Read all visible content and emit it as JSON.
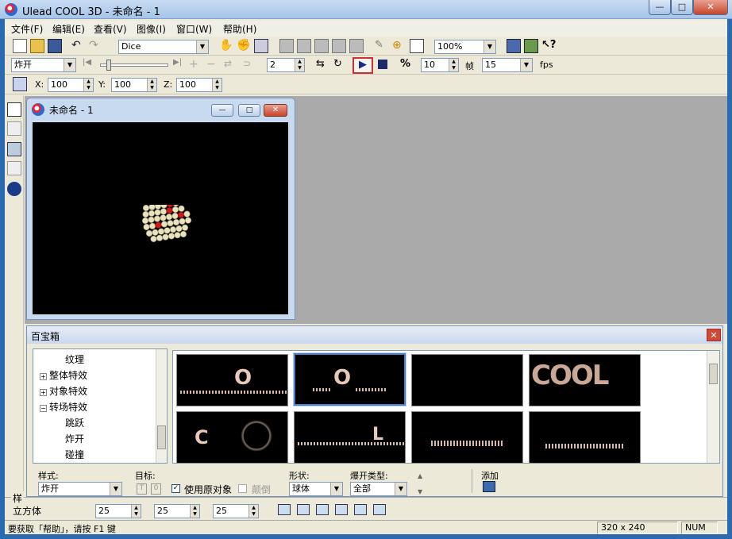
{
  "app": {
    "title": "Ulead COOL 3D - 未命名 - 1"
  },
  "window_buttons": {
    "min": "—",
    "max": "□",
    "close": "✕"
  },
  "menu": [
    "文件(F)",
    "编辑(E)",
    "查看(V)",
    "图像(I)",
    "窗口(W)",
    "帮助(H)"
  ],
  "toolbar1": {
    "font_style": "Dice",
    "zoom": "100%"
  },
  "toolbar2": {
    "effect": "炸开",
    "frame_value": "2",
    "speed": "10",
    "frame_label": "帧",
    "fps_value": "15",
    "fps_label": "fps"
  },
  "toolbar3": {
    "x_label": "X:",
    "x_value": "100",
    "y_label": "Y:",
    "y_value": "100",
    "z_label": "Z:",
    "z_value": "100"
  },
  "document": {
    "title": "未命名 - 1"
  },
  "gallery": {
    "title": "百宝箱",
    "tree": [
      {
        "label": "纹理",
        "indent": 2,
        "expander": ""
      },
      {
        "label": "整体特效",
        "indent": 1,
        "expander": "+"
      },
      {
        "label": "对象特效",
        "indent": 1,
        "expander": "+"
      },
      {
        "label": "转场特效",
        "indent": 1,
        "expander": "−"
      },
      {
        "label": "跳跃",
        "indent": 2,
        "expander": ""
      },
      {
        "label": "炸开",
        "indent": 2,
        "expander": ""
      },
      {
        "label": "碰撞",
        "indent": 2,
        "expander": ""
      }
    ],
    "thumbs": [
      "O",
      "O",
      "",
      "COOL",
      "C",
      "L",
      "",
      ""
    ]
  },
  "props": {
    "style_label": "样式:",
    "style_value": "炸开",
    "target_label": "目标:",
    "use_original_label": "使用原对象",
    "use_original_checked": true,
    "reverse_label": "颠倒",
    "shape_label": "形状:",
    "shape_value": "球体",
    "explode_label": "爆开类型:",
    "explode_value": "全部",
    "add_label": "添加"
  },
  "lower_panel": {
    "tab": "样",
    "object": "立方体",
    "v1": "25",
    "v2": "25",
    "v3": "25"
  },
  "status": {
    "help": "要获取「帮助」，请按 F1 键",
    "size": "320 x 240",
    "num": "NUM"
  },
  "colors": {
    "accent": "#d03030",
    "selection": "#4a7ec0"
  }
}
